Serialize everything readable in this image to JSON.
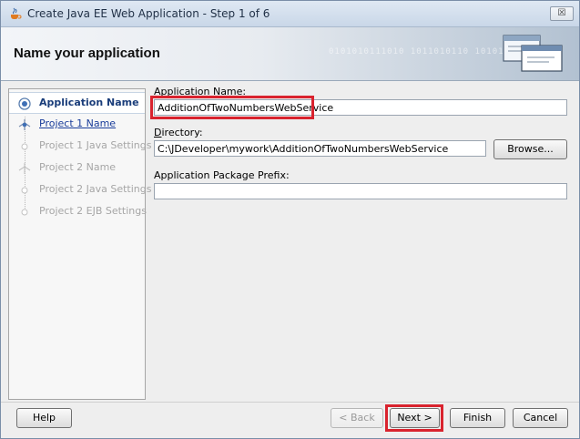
{
  "window": {
    "title": "Create Java EE Web Application - Step 1 of 6",
    "close_glyph": "☒"
  },
  "banner": {
    "heading": "Name your application",
    "decoration_text": "0101010111010 1011010110 101010 110101"
  },
  "steps": [
    {
      "label": "Application Name",
      "state": "active"
    },
    {
      "label": "Project 1 Name",
      "state": "link"
    },
    {
      "label": "Project 1 Java Settings",
      "state": "disabled"
    },
    {
      "label": "Project 2 Name",
      "state": "disabled"
    },
    {
      "label": "Project 2 Java Settings",
      "state": "disabled"
    },
    {
      "label": "Project 2 EJB Settings",
      "state": "disabled"
    }
  ],
  "form": {
    "app_name_label_mnemonic": "A",
    "app_name_label_rest": "pplication Name:",
    "app_name_value": "AdditionOfTwoNumbersWebService",
    "directory_label_mnemonic": "D",
    "directory_label_rest": "irectory:",
    "directory_value": "C:\\JDeveloper\\mywork\\AdditionOfTwoNumbersWebService",
    "browse_label": "Browse...",
    "package_label": "Application Package Prefix:",
    "package_value": ""
  },
  "footer": {
    "help": "Help",
    "back": "< Back",
    "next": "Next >",
    "finish": "Finish",
    "cancel": "Cancel"
  },
  "colors": {
    "highlight": "#d9232e",
    "accent": "#1a3d7a"
  }
}
